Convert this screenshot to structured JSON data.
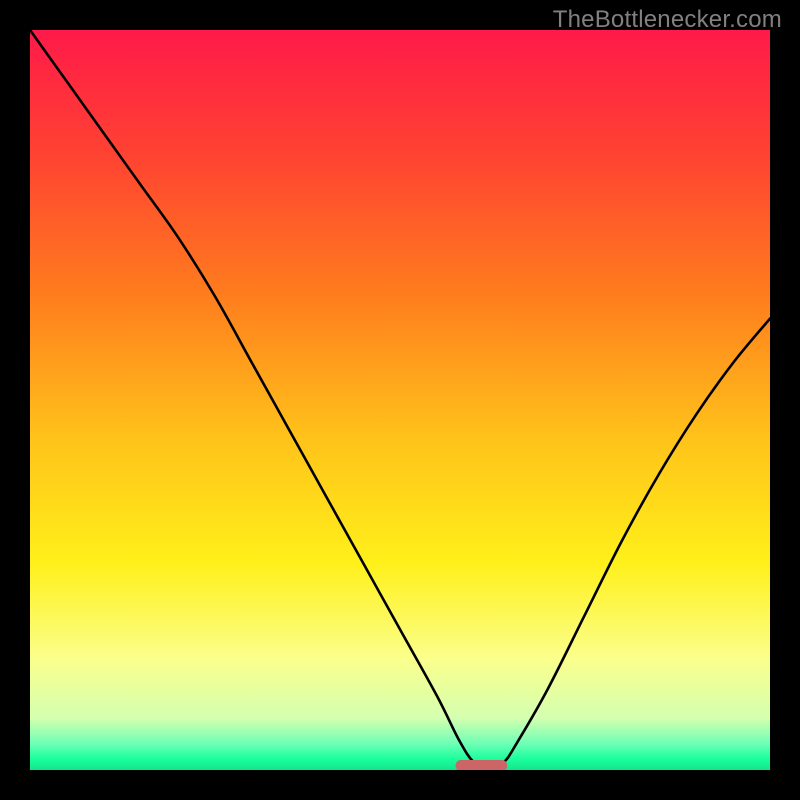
{
  "watermark": "TheBottlenecker.com",
  "chart_data": {
    "type": "line",
    "title": "",
    "xlabel": "",
    "ylabel": "",
    "xlim": [
      0,
      100
    ],
    "ylim": [
      0,
      100
    ],
    "x": [
      0,
      5,
      10,
      15,
      20,
      25,
      30,
      35,
      40,
      45,
      50,
      55,
      58,
      60,
      62,
      64,
      66,
      70,
      75,
      80,
      85,
      90,
      95,
      100
    ],
    "values": [
      100,
      93,
      86,
      79,
      72,
      64,
      55,
      46,
      37,
      28,
      19,
      10,
      4,
      1,
      0,
      1,
      4,
      11,
      21,
      31,
      40,
      48,
      55,
      61
    ],
    "gradient_stops": [
      {
        "t": 0.0,
        "color": "#ff1a49"
      },
      {
        "t": 0.16,
        "color": "#ff4033"
      },
      {
        "t": 0.35,
        "color": "#ff7a1e"
      },
      {
        "t": 0.55,
        "color": "#ffc21a"
      },
      {
        "t": 0.72,
        "color": "#fff01a"
      },
      {
        "t": 0.85,
        "color": "#fbff8c"
      },
      {
        "t": 0.93,
        "color": "#d4ffb0"
      },
      {
        "t": 0.965,
        "color": "#6bffb5"
      },
      {
        "t": 0.985,
        "color": "#1aff9c"
      },
      {
        "t": 1.0,
        "color": "#14e58c"
      }
    ],
    "marker": {
      "x": 61,
      "y": 0.6,
      "w": 7,
      "h": 1.5,
      "color": "#cc6666"
    }
  }
}
